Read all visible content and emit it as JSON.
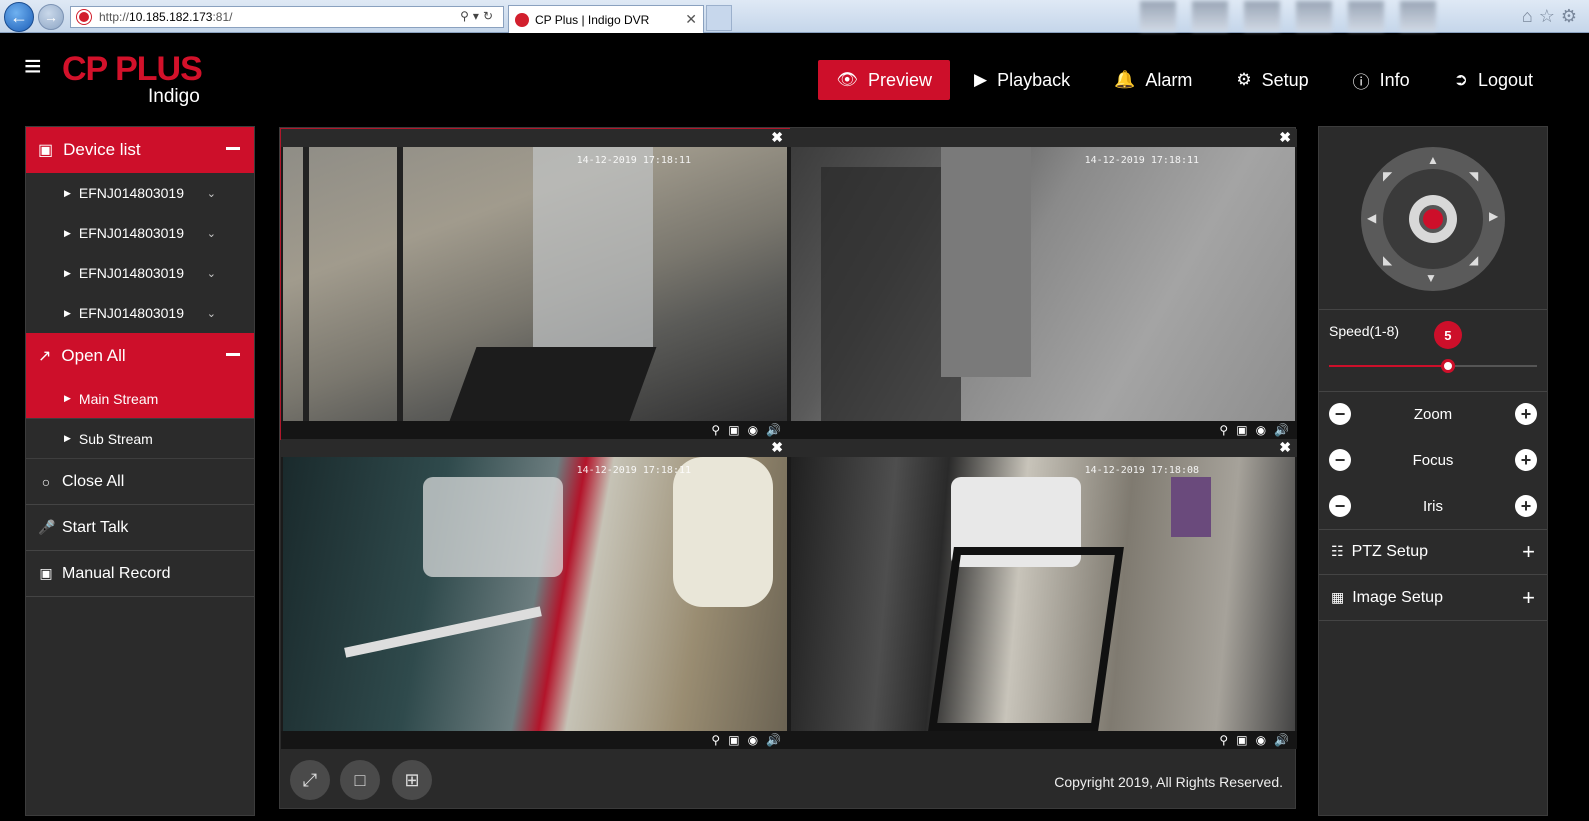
{
  "browser": {
    "address_url": "http://10.185.182.173:81/",
    "address_host": "10.185.182.173",
    "address_prefix": "http://",
    "address_port": ":81/",
    "tab_title": "CP Plus | Indigo DVR"
  },
  "brand": {
    "name": "CP PLUS",
    "sub": "Indigo",
    "accent": "#cd0f2a"
  },
  "nav": [
    {
      "label": "Preview",
      "icon": "eye-icon",
      "active": true
    },
    {
      "label": "Playback",
      "icon": "play-icon",
      "active": false
    },
    {
      "label": "Alarm",
      "icon": "bell-icon",
      "active": false
    },
    {
      "label": "Setup",
      "icon": "gear-icon",
      "active": false
    },
    {
      "label": "Info",
      "icon": "info-icon",
      "active": false
    },
    {
      "label": "Logout",
      "icon": "logout-icon",
      "active": false
    }
  ],
  "sidebar": {
    "device_list_label": "Device list",
    "devices": [
      "EFNJ014803019",
      "EFNJ014803019",
      "EFNJ014803019",
      "EFNJ014803019"
    ],
    "open_all_label": "Open All",
    "streams": [
      {
        "label": "Main Stream",
        "active": true
      },
      {
        "label": "Sub Stream",
        "active": false
      }
    ],
    "close_all_label": "Close All",
    "start_talk_label": "Start Talk",
    "manual_record_label": "Manual Record"
  },
  "cameras": [
    {
      "osd": "14-12-2019 17:18:11"
    },
    {
      "osd": "14-12-2019 17:18:11"
    },
    {
      "osd": "14-12-2019 17:18:11"
    },
    {
      "osd": "14-12-2019 17:18:08"
    }
  ],
  "footer": {
    "copyright": "Copyright 2019, All Rights Reserved."
  },
  "ptz": {
    "speed_label": "Speed(1-8)",
    "speed_value": "5",
    "speed_min": 1,
    "speed_max": 8,
    "rows": [
      "Zoom",
      "Focus",
      "Iris"
    ],
    "ptz_setup_label": "PTZ Setup",
    "image_setup_label": "Image Setup"
  }
}
